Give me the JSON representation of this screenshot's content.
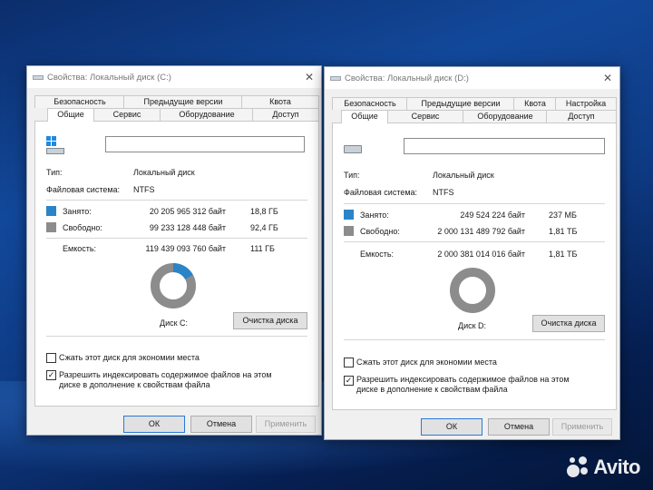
{
  "colors": {
    "used": "#2a84c8",
    "free": "#8c8c8c",
    "default_border": "#2a78d7"
  },
  "dialogs": [
    {
      "title": "Свойства: Локальный диск (C:)",
      "tabs_row1": [
        "Безопасность",
        "Предыдущие версии",
        "Квота"
      ],
      "tabs_row2": [
        "Общие",
        "Сервис",
        "Оборудование",
        "Доступ"
      ],
      "drive_name": "",
      "type_label": "Тип:",
      "type_value": "Локальный диск",
      "fs_label": "Файловая система:",
      "fs_value": "NTFS",
      "used_label": "Занято:",
      "used_bytes": "20 205 965 312 байт",
      "used_h": "18,8 ГБ",
      "free_label": "Свободно:",
      "free_bytes": "99 233 128 448 байт",
      "free_h": "92,4 ГБ",
      "cap_label": "Емкость:",
      "cap_bytes": "119 439 093 760 байт",
      "cap_h": "111 ГБ",
      "used_fraction": 0.169,
      "disk_label": "Диск C:",
      "cleanup": "Очистка диска",
      "compress": "Сжать этот диск для экономии места",
      "compress_checked": false,
      "index": "Разрешить индексировать содержимое файлов на этом диске в дополнение к свойствам файла",
      "index_checked": true,
      "ok": "ОК",
      "cancel": "Отмена",
      "apply": "Применить",
      "icon": "windows-drive-icon"
    },
    {
      "title": "Свойства: Локальный диск (D:)",
      "tabs_row1": [
        "Безопасность",
        "Предыдущие версии",
        "Квота",
        "Настройка"
      ],
      "tabs_row2": [
        "Общие",
        "Сервис",
        "Оборудование",
        "Доступ"
      ],
      "drive_name": "",
      "type_label": "Тип:",
      "type_value": "Локальный диск",
      "fs_label": "Файловая система:",
      "fs_value": "NTFS",
      "used_label": "Занято:",
      "used_bytes": "249 524 224 байт",
      "used_h": "237 МБ",
      "free_label": "Свободно:",
      "free_bytes": "2 000 131 489 792 байт",
      "free_h": "1,81 ТБ",
      "cap_label": "Емкость:",
      "cap_bytes": "2 000 381 014 016 байт",
      "cap_h": "1,81 ТБ",
      "used_fraction": 0.0001,
      "disk_label": "Диск D:",
      "cleanup": "Очистка диска",
      "compress": "Сжать этот диск для экономии места",
      "compress_checked": false,
      "index": "Разрешить индексировать содержимое файлов на этом диске в дополнение к свойствам файла",
      "index_checked": true,
      "ok": "ОК",
      "cancel": "Отмена",
      "apply": "Применить",
      "icon": "drive-icon"
    }
  ],
  "watermark": "Avito"
}
